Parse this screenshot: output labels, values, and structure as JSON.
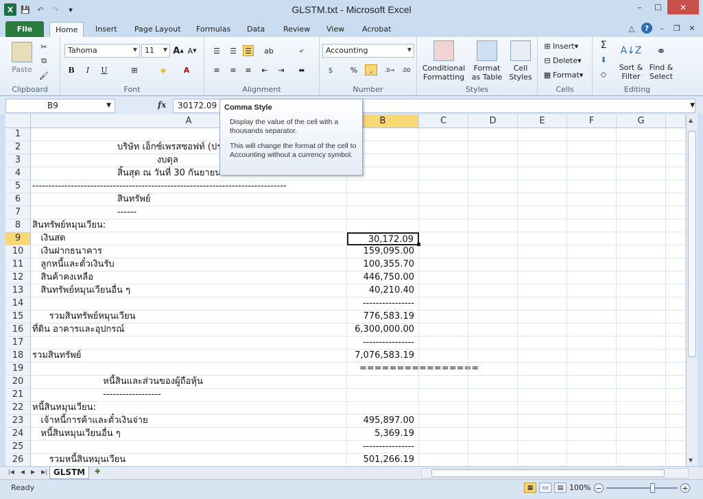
{
  "window": {
    "title": "GLSTM.txt - Microsoft Excel",
    "app_icon": "X",
    "controls": [
      "–",
      "☐",
      "✕"
    ]
  },
  "qat": {
    "icons": [
      "excel-app-icon",
      "save-icon",
      "undo-icon",
      "redo-icon",
      "customize-qat-icon"
    ]
  },
  "tabs": {
    "file": "File",
    "items": [
      "Home",
      "Insert",
      "Page Layout",
      "Formulas",
      "Data",
      "Review",
      "View",
      "Acrobat"
    ],
    "active": "Home"
  },
  "ribbon": {
    "clipboard": {
      "label": "Clipboard",
      "paste": "Paste"
    },
    "font": {
      "label": "Font",
      "name": "Tahoma",
      "size": "11",
      "bold": "B",
      "italic": "I",
      "underline": "U"
    },
    "alignment": {
      "label": "Alignment"
    },
    "number": {
      "label": "Number",
      "format": "Accounting",
      "percent": "%"
    },
    "styles": {
      "label": "Styles",
      "conditional": [
        "Conditional",
        "Formatting"
      ],
      "format_table": [
        "Format",
        "as Table"
      ],
      "cell_styles": [
        "Cell",
        "Styles"
      ]
    },
    "cells": {
      "label": "Cells",
      "insert": "Insert",
      "delete": "Delete",
      "format": "Format"
    },
    "editing": {
      "label": "Editing",
      "sort": [
        "Sort &",
        "Filter"
      ],
      "find": [
        "Find &",
        "Select"
      ]
    }
  },
  "formula_bar": {
    "name_box": "B9",
    "fx": "fx",
    "formula": "30172.09"
  },
  "columns": [
    "A",
    "B",
    "C",
    "D",
    "E",
    "F",
    "G"
  ],
  "selected_col": "B",
  "selected_row": "9",
  "rows": [
    {
      "n": "1",
      "a": "",
      "b": ""
    },
    {
      "n": "2",
      "a": "                              บริษัท เอ็กซ์เพรสซอฟท์ (ประเทศไทย) จำกัด",
      "b": ""
    },
    {
      "n": "3",
      "a": "                                            งบดุล",
      "b": ""
    },
    {
      "n": "4",
      "a": "                              สิ้นสุด ณ วันที่ 30 กันยายน 2550",
      "b": ""
    },
    {
      "n": "5",
      "a": "-------------------------------------------------------------------------------",
      "b": ""
    },
    {
      "n": "6",
      "a": "                              สินทรัพย์",
      "b": ""
    },
    {
      "n": "7",
      "a": "                              ------",
      "b": ""
    },
    {
      "n": "8",
      "a": "สินทรัพย์หมุนเวียน:",
      "b": ""
    },
    {
      "n": "9",
      "a": "   เงินสด",
      "b": "30,172.09"
    },
    {
      "n": "10",
      "a": "   เงินฝากธนาคาร",
      "b": "159,095.00"
    },
    {
      "n": "11",
      "a": "   ลูกหนี้และตั๋วเงินรับ",
      "b": "100,355.70"
    },
    {
      "n": "12",
      "a": "   สินค้าคงเหลือ",
      "b": "446,750.00"
    },
    {
      "n": "13",
      "a": "   สินทรัพย์หมุนเวียนอื่น ๆ",
      "b": "40,210.40"
    },
    {
      "n": "14",
      "a": "",
      "b": "----------------"
    },
    {
      "n": "15",
      "a": "      รวมสินทรัพย์หมุนเวียน",
      "b": "776,583.19"
    },
    {
      "n": "16",
      "a": "ที่ดิน อาคารและอุปกรณ์",
      "b": "6,300,000.00"
    },
    {
      "n": "17",
      "a": "",
      "b": "----------------"
    },
    {
      "n": "18",
      "a": "รวมสินทรัพย์",
      "b": "7,076,583.19"
    },
    {
      "n": "19",
      "a": "",
      "b": "================"
    },
    {
      "n": "20",
      "a": "                         หนี้สินและส่วนของผู้ถือหุ้น",
      "b": ""
    },
    {
      "n": "21",
      "a": "                         ------------------",
      "b": ""
    },
    {
      "n": "22",
      "a": "หนี้สินหมุนเวียน:",
      "b": ""
    },
    {
      "n": "23",
      "a": "   เจ้าหนี้การค้าและตั๋วเงินจ่าย",
      "b": "495,897.00"
    },
    {
      "n": "24",
      "a": "   หนี้สินหมุนเวียนอื่น ๆ",
      "b": "5,369.19"
    },
    {
      "n": "25",
      "a": "",
      "b": "----------------"
    },
    {
      "n": "26",
      "a": "      รวมหนี้สินหมุนเวียน",
      "b": "501,266.19"
    }
  ],
  "tooltip": {
    "title": "Comma Style",
    "line1": "Display the value of the cell with a thousands separator.",
    "line2": "This will change the format of the cell to Accounting without a currency symbol."
  },
  "sheet_tabs": [
    "GLSTM"
  ],
  "status": {
    "text": "Ready",
    "zoom": "100%"
  }
}
